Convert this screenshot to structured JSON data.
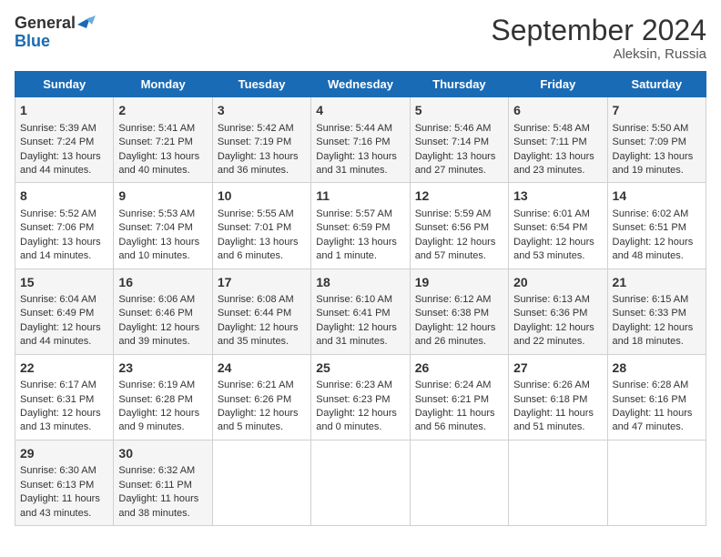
{
  "header": {
    "logo_line1": "General",
    "logo_line2": "Blue",
    "title": "September 2024",
    "subtitle": "Aleksin, Russia"
  },
  "days_of_week": [
    "Sunday",
    "Monday",
    "Tuesday",
    "Wednesday",
    "Thursday",
    "Friday",
    "Saturday"
  ],
  "weeks": [
    [
      {
        "day": "1",
        "sunrise": "Sunrise: 5:39 AM",
        "sunset": "Sunset: 7:24 PM",
        "daylight": "Daylight: 13 hours and 44 minutes."
      },
      {
        "day": "2",
        "sunrise": "Sunrise: 5:41 AM",
        "sunset": "Sunset: 7:21 PM",
        "daylight": "Daylight: 13 hours and 40 minutes."
      },
      {
        "day": "3",
        "sunrise": "Sunrise: 5:42 AM",
        "sunset": "Sunset: 7:19 PM",
        "daylight": "Daylight: 13 hours and 36 minutes."
      },
      {
        "day": "4",
        "sunrise": "Sunrise: 5:44 AM",
        "sunset": "Sunset: 7:16 PM",
        "daylight": "Daylight: 13 hours and 31 minutes."
      },
      {
        "day": "5",
        "sunrise": "Sunrise: 5:46 AM",
        "sunset": "Sunset: 7:14 PM",
        "daylight": "Daylight: 13 hours and 27 minutes."
      },
      {
        "day": "6",
        "sunrise": "Sunrise: 5:48 AM",
        "sunset": "Sunset: 7:11 PM",
        "daylight": "Daylight: 13 hours and 23 minutes."
      },
      {
        "day": "7",
        "sunrise": "Sunrise: 5:50 AM",
        "sunset": "Sunset: 7:09 PM",
        "daylight": "Daylight: 13 hours and 19 minutes."
      }
    ],
    [
      {
        "day": "8",
        "sunrise": "Sunrise: 5:52 AM",
        "sunset": "Sunset: 7:06 PM",
        "daylight": "Daylight: 13 hours and 14 minutes."
      },
      {
        "day": "9",
        "sunrise": "Sunrise: 5:53 AM",
        "sunset": "Sunset: 7:04 PM",
        "daylight": "Daylight: 13 hours and 10 minutes."
      },
      {
        "day": "10",
        "sunrise": "Sunrise: 5:55 AM",
        "sunset": "Sunset: 7:01 PM",
        "daylight": "Daylight: 13 hours and 6 minutes."
      },
      {
        "day": "11",
        "sunrise": "Sunrise: 5:57 AM",
        "sunset": "Sunset: 6:59 PM",
        "daylight": "Daylight: 13 hours and 1 minute."
      },
      {
        "day": "12",
        "sunrise": "Sunrise: 5:59 AM",
        "sunset": "Sunset: 6:56 PM",
        "daylight": "Daylight: 12 hours and 57 minutes."
      },
      {
        "day": "13",
        "sunrise": "Sunrise: 6:01 AM",
        "sunset": "Sunset: 6:54 PM",
        "daylight": "Daylight: 12 hours and 53 minutes."
      },
      {
        "day": "14",
        "sunrise": "Sunrise: 6:02 AM",
        "sunset": "Sunset: 6:51 PM",
        "daylight": "Daylight: 12 hours and 48 minutes."
      }
    ],
    [
      {
        "day": "15",
        "sunrise": "Sunrise: 6:04 AM",
        "sunset": "Sunset: 6:49 PM",
        "daylight": "Daylight: 12 hours and 44 minutes."
      },
      {
        "day": "16",
        "sunrise": "Sunrise: 6:06 AM",
        "sunset": "Sunset: 6:46 PM",
        "daylight": "Daylight: 12 hours and 39 minutes."
      },
      {
        "day": "17",
        "sunrise": "Sunrise: 6:08 AM",
        "sunset": "Sunset: 6:44 PM",
        "daylight": "Daylight: 12 hours and 35 minutes."
      },
      {
        "day": "18",
        "sunrise": "Sunrise: 6:10 AM",
        "sunset": "Sunset: 6:41 PM",
        "daylight": "Daylight: 12 hours and 31 minutes."
      },
      {
        "day": "19",
        "sunrise": "Sunrise: 6:12 AM",
        "sunset": "Sunset: 6:38 PM",
        "daylight": "Daylight: 12 hours and 26 minutes."
      },
      {
        "day": "20",
        "sunrise": "Sunrise: 6:13 AM",
        "sunset": "Sunset: 6:36 PM",
        "daylight": "Daylight: 12 hours and 22 minutes."
      },
      {
        "day": "21",
        "sunrise": "Sunrise: 6:15 AM",
        "sunset": "Sunset: 6:33 PM",
        "daylight": "Daylight: 12 hours and 18 minutes."
      }
    ],
    [
      {
        "day": "22",
        "sunrise": "Sunrise: 6:17 AM",
        "sunset": "Sunset: 6:31 PM",
        "daylight": "Daylight: 12 hours and 13 minutes."
      },
      {
        "day": "23",
        "sunrise": "Sunrise: 6:19 AM",
        "sunset": "Sunset: 6:28 PM",
        "daylight": "Daylight: 12 hours and 9 minutes."
      },
      {
        "day": "24",
        "sunrise": "Sunrise: 6:21 AM",
        "sunset": "Sunset: 6:26 PM",
        "daylight": "Daylight: 12 hours and 5 minutes."
      },
      {
        "day": "25",
        "sunrise": "Sunrise: 6:23 AM",
        "sunset": "Sunset: 6:23 PM",
        "daylight": "Daylight: 12 hours and 0 minutes."
      },
      {
        "day": "26",
        "sunrise": "Sunrise: 6:24 AM",
        "sunset": "Sunset: 6:21 PM",
        "daylight": "Daylight: 11 hours and 56 minutes."
      },
      {
        "day": "27",
        "sunrise": "Sunrise: 6:26 AM",
        "sunset": "Sunset: 6:18 PM",
        "daylight": "Daylight: 11 hours and 51 minutes."
      },
      {
        "day": "28",
        "sunrise": "Sunrise: 6:28 AM",
        "sunset": "Sunset: 6:16 PM",
        "daylight": "Daylight: 11 hours and 47 minutes."
      }
    ],
    [
      {
        "day": "29",
        "sunrise": "Sunrise: 6:30 AM",
        "sunset": "Sunset: 6:13 PM",
        "daylight": "Daylight: 11 hours and 43 minutes."
      },
      {
        "day": "30",
        "sunrise": "Sunrise: 6:32 AM",
        "sunset": "Sunset: 6:11 PM",
        "daylight": "Daylight: 11 hours and 38 minutes."
      },
      null,
      null,
      null,
      null,
      null
    ]
  ]
}
